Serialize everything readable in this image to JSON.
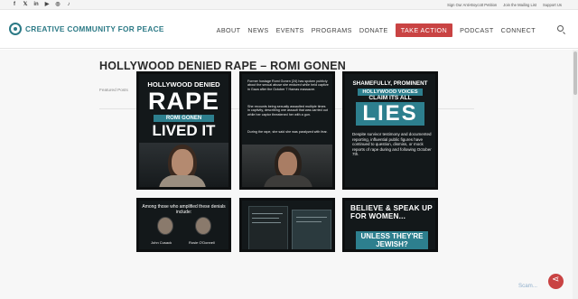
{
  "topbar": {
    "social_icons": [
      "facebook-icon",
      "x-icon",
      "linkedin-icon",
      "youtube-icon",
      "instagram-icon",
      "tiktok-icon"
    ],
    "social_glyphs": [
      "f",
      "𝕏",
      "in",
      "▶",
      "◎",
      "♪"
    ],
    "links": [
      "Sign Our Anti-Boycott Petition",
      "Join the Mailing List",
      "Support Us"
    ]
  },
  "header": {
    "logo_text": "CREATIVE COMMUNITY FOR PEACE",
    "nav": [
      "ABOUT",
      "NEWS",
      "EVENTS",
      "PROGRAMS",
      "DONATE",
      "TAKE ACTION",
      "PODCAST",
      "CONNECT"
    ],
    "accent": "#c94343",
    "brand": "#2c7a86"
  },
  "post": {
    "title": "HOLLYWOOD DENIED RAPE – ROMI GONEN",
    "category": "Featured Posts"
  },
  "tiles": {
    "t1": {
      "line1": "HOLLYWOOD DENIED",
      "line2": "RAPE",
      "band": "ROMI GONEN",
      "line3": "LIVED IT"
    },
    "t2": {
      "p1": "Former hostage Romi Gonen (24) has spoken publicly about the sexual abuse she endured while held captive in Gaza after the October 7 Hamas massacre.",
      "p2": "She recounts being sexually assaulted multiple times in captivity, describing one assault that was carried out while her captor threatened her with a gun.",
      "p3": "During the rape, she said she was paralyzed with fear."
    },
    "t3": {
      "line1": "SHAMEFULLY, PROMINENT",
      "band": "HOLLYWOOD VOICES",
      "line2": "CLAIM ITS ALL",
      "big": "LIES",
      "p": "Despite survivor testimony and documented reporting, influential public figures have continued to question, dismiss, or mock reports of rape during and following October 7th."
    },
    "t4": {
      "intro": "Among those who amplified these denials include:",
      "names": [
        "John Cusack",
        "Rosie O'Donnell"
      ]
    },
    "t6": {
      "line1": "BELIEVE & SPEAK UP FOR WOMEN...",
      "band": "UNLESS THEY'RE JEWISH?"
    }
  },
  "watermark": "Scam..."
}
